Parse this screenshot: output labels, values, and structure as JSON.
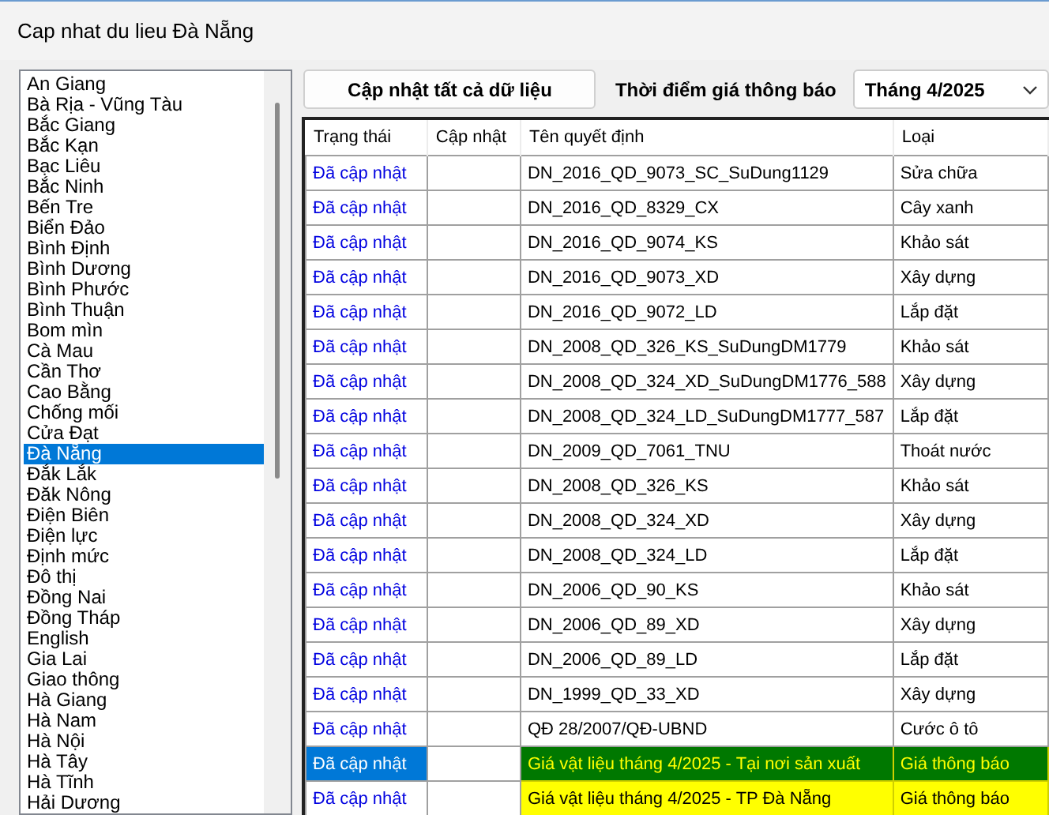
{
  "window": {
    "title": "Cap nhat du lieu Đà Nẵng"
  },
  "province_list": {
    "items": [
      {
        "label": "An Giang",
        "selected": false
      },
      {
        "label": "Bà Rịa - Vũng Tàu",
        "selected": false
      },
      {
        "label": "Bắc Giang",
        "selected": false
      },
      {
        "label": "Bắc Kạn",
        "selected": false
      },
      {
        "label": "Bạc Liêu",
        "selected": false
      },
      {
        "label": "Bắc Ninh",
        "selected": false
      },
      {
        "label": "Bến Tre",
        "selected": false
      },
      {
        "label": "Biển Đảo",
        "selected": false
      },
      {
        "label": "Bình Định",
        "selected": false
      },
      {
        "label": "Bình Dương",
        "selected": false
      },
      {
        "label": "Bình Phước",
        "selected": false
      },
      {
        "label": "Bình Thuận",
        "selected": false
      },
      {
        "label": "Bom mìn",
        "selected": false
      },
      {
        "label": "Cà Mau",
        "selected": false
      },
      {
        "label": "Cần Thơ",
        "selected": false
      },
      {
        "label": "Cao Bằng",
        "selected": false
      },
      {
        "label": "Chống mối",
        "selected": false
      },
      {
        "label": "Cửa Đạt",
        "selected": false
      },
      {
        "label": "Đà Nẵng",
        "selected": true
      },
      {
        "label": "Đắk Lắk",
        "selected": false
      },
      {
        "label": "Đăk Nông",
        "selected": false
      },
      {
        "label": "Điện Biên",
        "selected": false
      },
      {
        "label": "Điện lực",
        "selected": false
      },
      {
        "label": "Định mức",
        "selected": false
      },
      {
        "label": "Đô thị",
        "selected": false
      },
      {
        "label": "Đồng Nai",
        "selected": false
      },
      {
        "label": "Đồng Tháp",
        "selected": false
      },
      {
        "label": "English",
        "selected": false
      },
      {
        "label": "Gia Lai",
        "selected": false
      },
      {
        "label": "Giao thông",
        "selected": false
      },
      {
        "label": "Hà Giang",
        "selected": false
      },
      {
        "label": "Hà Nam",
        "selected": false
      },
      {
        "label": "Hà Nội",
        "selected": false
      },
      {
        "label": "Hà Tây",
        "selected": false
      },
      {
        "label": "Hà Tĩnh",
        "selected": false
      },
      {
        "label": "Hải Dương",
        "selected": false
      }
    ]
  },
  "update_all_button": "Cập nhật tất cả dữ liệu",
  "price_time": {
    "label": "Thời điểm giá thông báo",
    "value": "Tháng 4/2025"
  },
  "table": {
    "columns": [
      "Trạng thái",
      "Cập nhật",
      "Tên quyết định",
      "Loại"
    ],
    "rows": [
      {
        "status": "Đã cập nhật",
        "name": "DN_2016_QD_9073_SC_SuDung1129",
        "type": "Sửa chữa",
        "selected": false
      },
      {
        "status": "Đã cập nhật",
        "name": "DN_2016_QD_8329_CX",
        "type": "Cây xanh",
        "selected": false
      },
      {
        "status": "Đã cập nhật",
        "name": "DN_2016_QD_9074_KS",
        "type": "Khảo sát",
        "selected": false
      },
      {
        "status": "Đã cập nhật",
        "name": "DN_2016_QD_9073_XD",
        "type": "Xây dựng",
        "selected": false
      },
      {
        "status": "Đã cập nhật",
        "name": "DN_2016_QD_9072_LD",
        "type": "Lắp đặt",
        "selected": false
      },
      {
        "status": "Đã cập nhật",
        "name": "DN_2008_QD_326_KS_SuDungDM1779",
        "type": "Khảo sát",
        "selected": false
      },
      {
        "status": "Đã cập nhật",
        "name": "DN_2008_QD_324_XD_SuDungDM1776_588",
        "type": "Xây dựng",
        "selected": false
      },
      {
        "status": "Đã cập nhật",
        "name": "DN_2008_QD_324_LD_SuDungDM1777_587",
        "type": "Lắp đặt",
        "selected": false
      },
      {
        "status": "Đã cập nhật",
        "name": "DN_2009_QD_7061_TNU",
        "type": "Thoát nước",
        "selected": false
      },
      {
        "status": "Đã cập nhật",
        "name": "DN_2008_QD_326_KS",
        "type": "Khảo sát",
        "selected": false
      },
      {
        "status": "Đã cập nhật",
        "name": "DN_2008_QD_324_XD",
        "type": "Xây dựng",
        "selected": false
      },
      {
        "status": "Đã cập nhật",
        "name": "DN_2008_QD_324_LD",
        "type": "Lắp đặt",
        "selected": false
      },
      {
        "status": "Đã cập nhật",
        "name": "DN_2006_QD_90_KS",
        "type": "Khảo sát",
        "selected": false
      },
      {
        "status": "Đã cập nhật",
        "name": "DN_2006_QD_89_XD",
        "type": "Xây dựng",
        "selected": false
      },
      {
        "status": "Đã cập nhật",
        "name": "DN_2006_QD_89_LD",
        "type": "Lắp đặt",
        "selected": false
      },
      {
        "status": "Đã cập nhật",
        "name": "DN_1999_QD_33_XD",
        "type": "Xây dựng",
        "selected": false
      },
      {
        "status": "Đã cập nhật",
        "name": "QĐ 28/2007/QĐ-UBND",
        "type": "Cước ô tô",
        "selected": false
      },
      {
        "status": "Đã cập nhật",
        "name": "Giá vật liệu tháng 4/2025 - Tại nơi sản xuất",
        "type": "Giá thông báo",
        "selected": true,
        "color": "#007800"
      },
      {
        "status": "Đã cập nhật",
        "name": "Giá vật liệu tháng 4/2025 - TP Đà Nẵng",
        "type": "Giá thông báo",
        "selected": false,
        "color": "#ffff00"
      }
    ]
  }
}
